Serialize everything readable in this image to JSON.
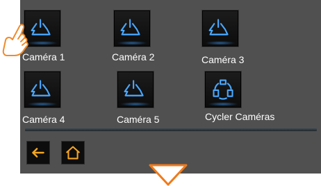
{
  "cameras": [
    {
      "label": "Caméra 1",
      "icon": "camera-icon"
    },
    {
      "label": "Caméra 2",
      "icon": "camera-icon"
    },
    {
      "label": "Caméra 3",
      "icon": "camera-icon"
    },
    {
      "label": "Caméra 4",
      "icon": "camera-icon"
    },
    {
      "label": "Caméra 5",
      "icon": "camera-icon"
    },
    {
      "label": "Cycler Caméras",
      "icon": "cycle-cameras-icon"
    }
  ],
  "nav": {
    "back_icon": "back-arrow-icon",
    "home_icon": "home-icon"
  },
  "colors": {
    "panel": "#505050",
    "icon_blue": "#4aa8ff",
    "nav_orange": "#f5a623",
    "arrow_orange": "#f07a1a"
  }
}
